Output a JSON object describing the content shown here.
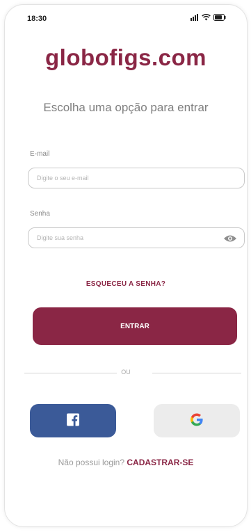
{
  "status_bar": {
    "time": "18:30",
    "icons": [
      "signal-icon",
      "wifi-icon",
      "battery-icon"
    ]
  },
  "brand": {
    "logo_text": "globofigs.com",
    "accent_color": "#8a2645"
  },
  "subtitle": "Escolha uma opção para entrar",
  "form": {
    "email_label": "E-mail",
    "email_value": "",
    "email_placeholder": "Digite o seu e-mail",
    "password_label": "Senha",
    "password_value": "",
    "password_placeholder": "Digite sua senha",
    "password_toggle_icon": "eye-icon",
    "forgot_label": "ESQUECEU A SENHA?",
    "submit_label": "ENTRAR"
  },
  "divider_text": "OU",
  "social": {
    "facebook_icon": "facebook-icon",
    "facebook_color": "#3b5a98",
    "google_icon": "google-icon",
    "google_bg": "#ececec"
  },
  "signup": {
    "prompt": "Não possui login?",
    "link_label": "CADASTRAR-SE"
  }
}
